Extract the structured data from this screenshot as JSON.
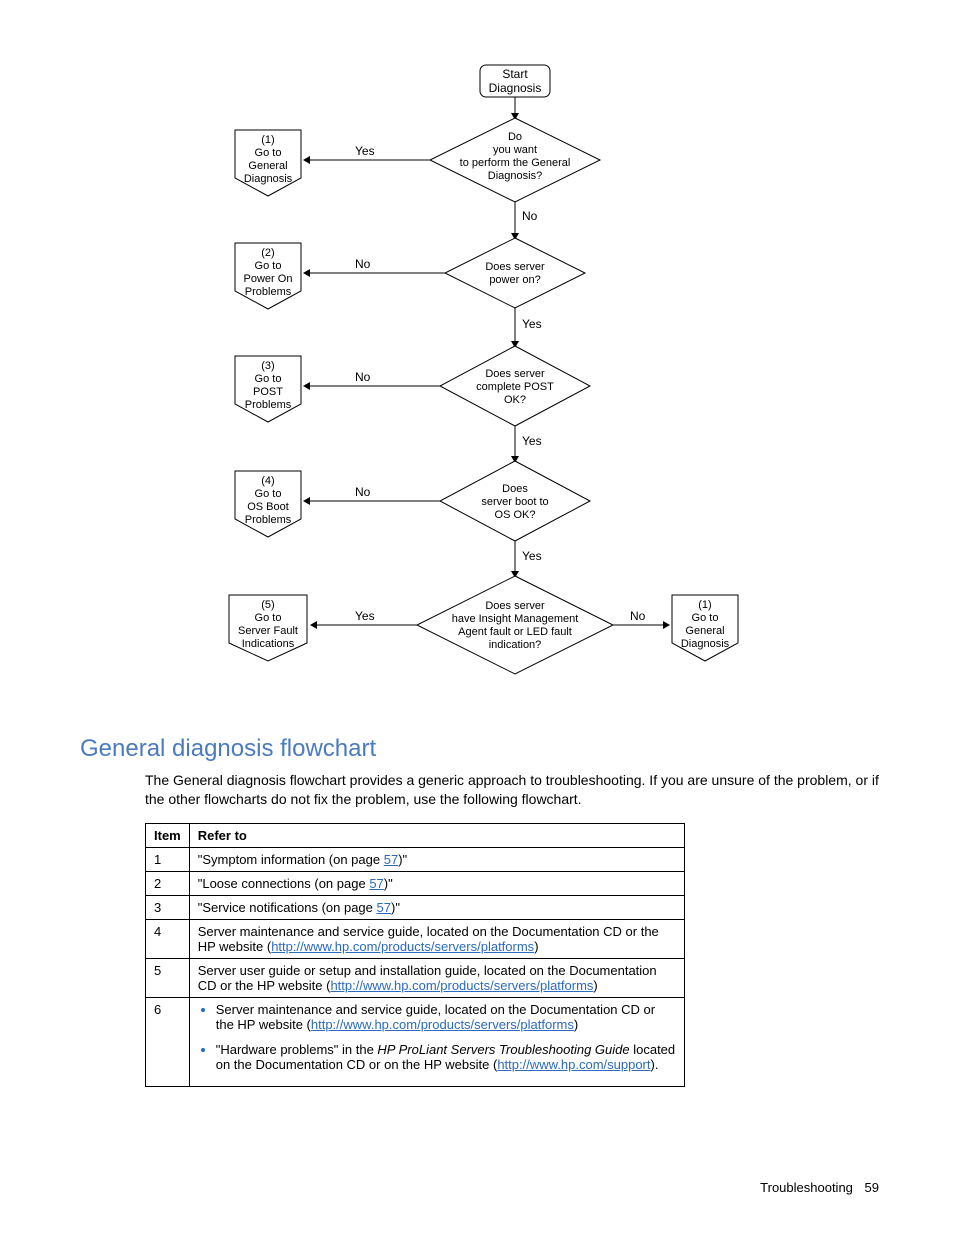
{
  "flowchart": {
    "start": {
      "l1": "Start",
      "l2": "Diagnosis"
    },
    "d1": {
      "l1": "Do",
      "l2": "you want",
      "l3": "to perform the General",
      "l4": "Diagnosis?"
    },
    "d2": {
      "l1": "Does server",
      "l2": "power on?"
    },
    "d3": {
      "l1": "Does server",
      "l2": "complete POST",
      "l3": "OK?"
    },
    "d4": {
      "l1": "Does",
      "l2": "server boot to",
      "l3": "OS OK?"
    },
    "d5": {
      "l1": "Does server",
      "l2": "have Insight Management",
      "l3": "Agent fault or LED fault",
      "l4": "indication?"
    },
    "b1": {
      "num": "(1)",
      "l1": "Go to",
      "l2": "General",
      "l3": "Diagnosis"
    },
    "b2": {
      "num": "(2)",
      "l1": "Go to",
      "l2": "Power On",
      "l3": "Problems"
    },
    "b3": {
      "num": "(3)",
      "l1": "Go to",
      "l2": "POST",
      "l3": "Problems"
    },
    "b4": {
      "num": "(4)",
      "l1": "Go to",
      "l2": "OS Boot",
      "l3": "Problems"
    },
    "b5": {
      "num": "(5)",
      "l1": "Go to",
      "l2": "Server Fault",
      "l3": "Indications"
    },
    "b6": {
      "num": "(1)",
      "l1": "Go to",
      "l2": "General",
      "l3": "Diagnosis"
    },
    "yes": "Yes",
    "no": "No"
  },
  "section_title": "General diagnosis flowchart",
  "intro": "The General diagnosis flowchart provides a generic approach to troubleshooting. If you are unsure of the problem, or if the other flowcharts do not fix the problem, use the following flowchart.",
  "table": {
    "h1": "Item",
    "h2": "Refer to",
    "rows": {
      "r1": {
        "item": "1",
        "t1": "\"Symptom information (on page ",
        "p": "57",
        "t2": ")\""
      },
      "r2": {
        "item": "2",
        "t1": "\"Loose connections (on page ",
        "p": "57",
        "t2": ")\""
      },
      "r3": {
        "item": "3",
        "t1": "\"Service notifications (on page ",
        "p": "57",
        "t2": ")\""
      },
      "r4": {
        "item": "4",
        "t1": "Server maintenance and service guide, located on the Documentation CD or the HP website (",
        "link": "http://www.hp.com/products/servers/platforms",
        "t2": ")"
      },
      "r5": {
        "item": "5",
        "t1": "Server user guide or setup and installation guide, located on the Documentation CD or the HP website (",
        "link": "http://www.hp.com/products/servers/platforms",
        "t2": ")"
      },
      "r6": {
        "item": "6",
        "li1_t1": "Server maintenance and service guide, located on the Documentation CD or the HP website (",
        "li1_link": "http://www.hp.com/products/servers/platforms",
        "li1_t2": ")",
        "li2_t1": "\"Hardware problems\" in the ",
        "li2_it": "HP ProLiant Servers Troubleshooting Guide",
        "li2_t2": " located on the Documentation CD or on the HP website (",
        "li2_link": "http://www.hp.com/support",
        "li2_t3": ")."
      }
    }
  },
  "footer": {
    "label": "Troubleshooting",
    "page": "59"
  }
}
